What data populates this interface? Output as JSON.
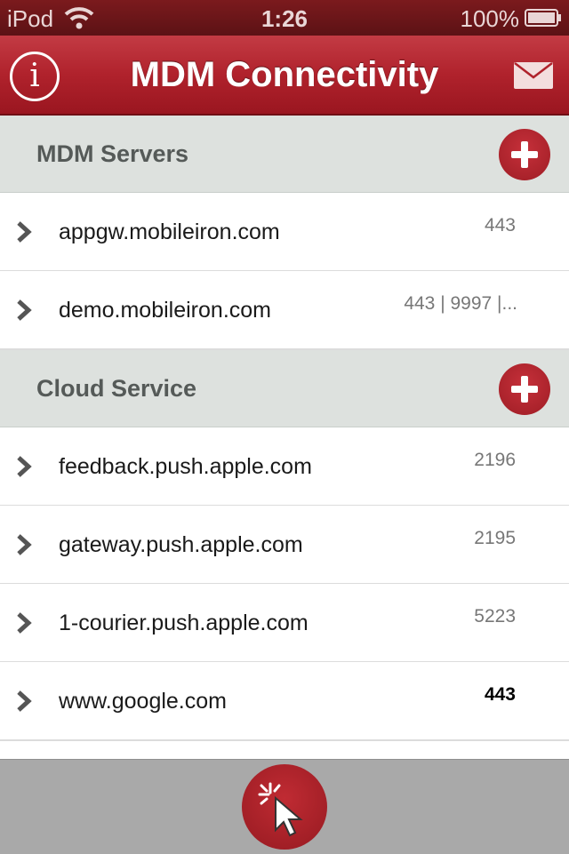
{
  "status_bar": {
    "carrier": "iPod",
    "time": "1:26",
    "battery": "100%"
  },
  "nav": {
    "title": "MDM Connectivity",
    "info_label": "i"
  },
  "sections": [
    {
      "title": "MDM Servers",
      "rows": [
        {
          "host": "appgw.mobileiron.com",
          "port": "443"
        },
        {
          "host": "demo.mobileiron.com",
          "port": "443 | 9997 |..."
        }
      ]
    },
    {
      "title": "Cloud Service",
      "rows": [
        {
          "host": "feedback.push.apple.com",
          "port": "2196"
        },
        {
          "host": "gateway.push.apple.com",
          "port": "2195"
        },
        {
          "host": "1-courier.push.apple.com",
          "port": "5223"
        },
        {
          "host": "www.google.com",
          "port": "443"
        }
      ]
    }
  ],
  "icons": {
    "info": "info-icon",
    "mail": "mail-icon",
    "add": "plus-icon",
    "chevron": "chevron-right-icon",
    "test": "cursor-click-icon"
  },
  "colors": {
    "accent": "#b0222c",
    "section_bg": "#dde1de",
    "bottom_bar": "#a9a9a9"
  }
}
